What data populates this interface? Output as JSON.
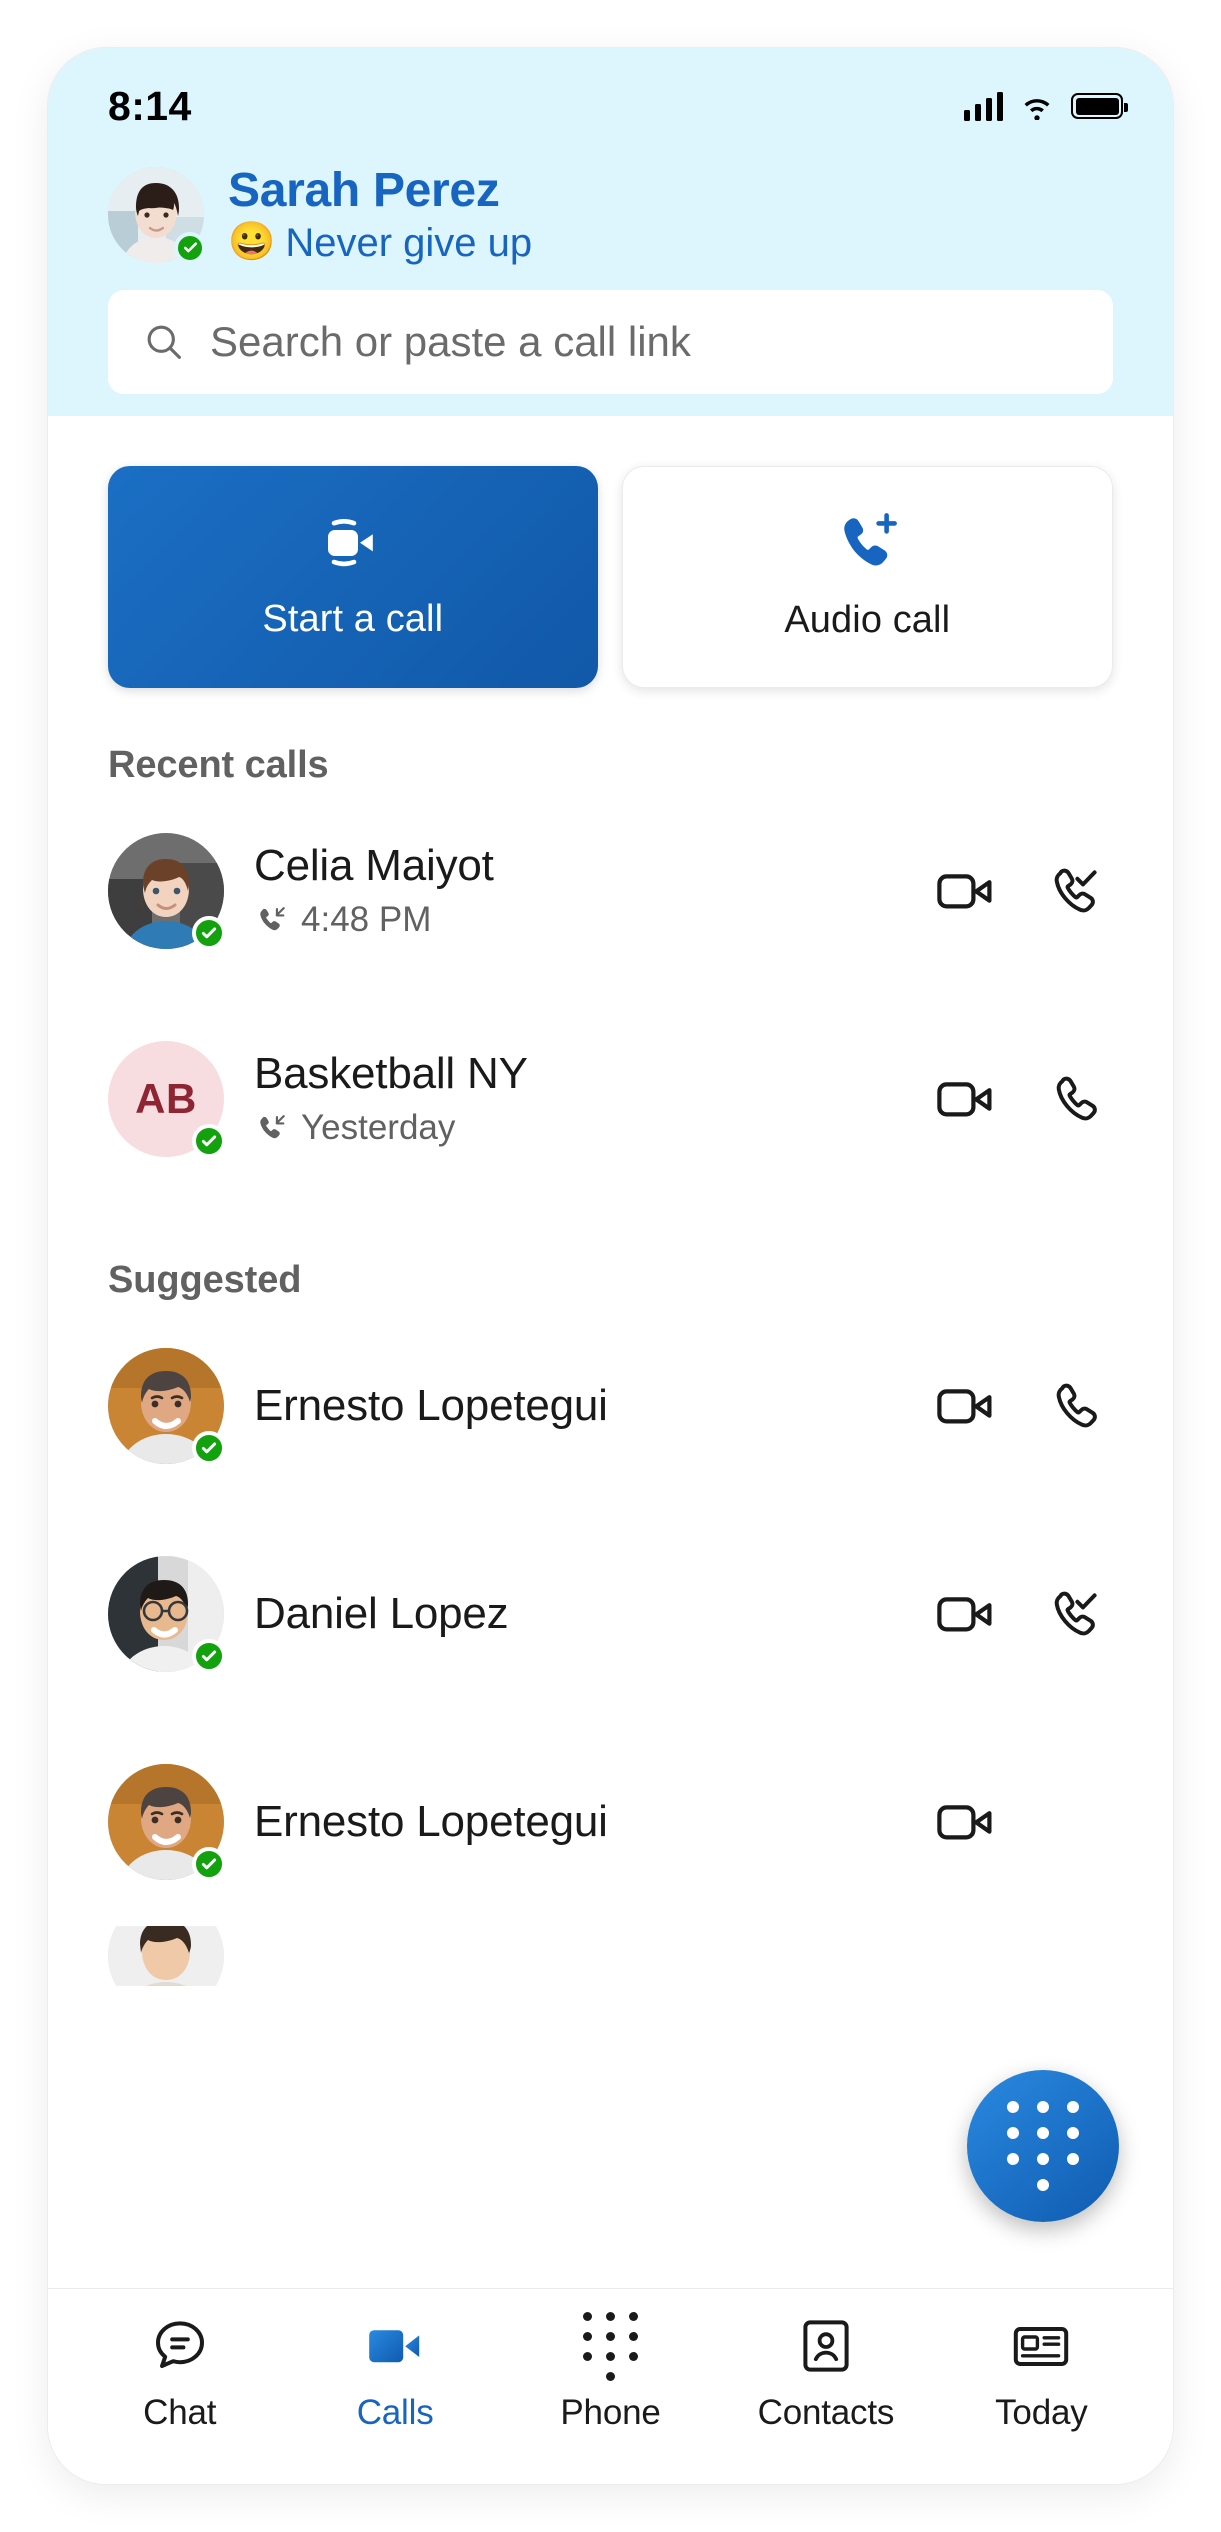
{
  "statusbar": {
    "time": "8:14",
    "signal_icon": "cellular-signal-icon",
    "wifi_icon": "wifi-icon",
    "battery_icon": "battery-full-icon"
  },
  "profile": {
    "name": "Sarah Perez",
    "status_emoji": "😀",
    "status_text": "Never give up",
    "presence": "available"
  },
  "search": {
    "placeholder": "Search or paste a call link",
    "value": "",
    "icon": "search-icon"
  },
  "actions": [
    {
      "label": "Start a call",
      "icon": "video-call-icon",
      "style": "primary"
    },
    {
      "label": "Audio call",
      "icon": "phone-add-icon",
      "style": "secondary"
    }
  ],
  "sections": [
    {
      "title": "Recent calls",
      "rows": [
        {
          "name": "Celia Maiyot",
          "sub": "4:48 PM",
          "sub_icon": "incoming-call-icon",
          "avatar": "photo",
          "presence": "available",
          "video_icon": "video-camera-icon",
          "call_icon": "phone-check-icon"
        },
        {
          "name": "Basketball NY",
          "sub": "Yesterday",
          "sub_icon": "incoming-call-icon",
          "avatar": "initials",
          "initials": "AB",
          "presence": "available",
          "video_icon": "video-camera-icon",
          "call_icon": "phone-icon"
        }
      ]
    },
    {
      "title": "Suggested",
      "rows": [
        {
          "name": "Ernesto Lopetegui",
          "sub": "",
          "avatar": "photo",
          "presence": "available",
          "video_icon": "video-camera-icon",
          "call_icon": "phone-icon"
        },
        {
          "name": "Daniel Lopez",
          "sub": "",
          "avatar": "photo",
          "presence": "available",
          "video_icon": "video-camera-icon",
          "call_icon": "phone-check-icon"
        },
        {
          "name": "Ernesto Lopetegui",
          "sub": "",
          "avatar": "photo",
          "presence": "available",
          "video_icon": "video-camera-icon",
          "call_icon": "phone-icon"
        }
      ]
    }
  ],
  "fab": {
    "icon": "dialpad-icon"
  },
  "tabs": [
    {
      "label": "Chat",
      "icon": "chat-bubble-icon",
      "active": false
    },
    {
      "label": "Calls",
      "icon": "video-camera-filled-icon",
      "active": true
    },
    {
      "label": "Phone",
      "icon": "dialpad-icon",
      "active": false
    },
    {
      "label": "Contacts",
      "icon": "contact-card-icon",
      "active": false
    },
    {
      "label": "Today",
      "icon": "newspaper-icon",
      "active": false
    }
  ],
  "colors": {
    "header_bg": "#DDF6FD",
    "accent": "#1765C0",
    "primary_button": "#1158A8",
    "presence_green": "#13A10E",
    "initials_bg": "#F7DDE0",
    "initials_fg": "#8F2433"
  }
}
